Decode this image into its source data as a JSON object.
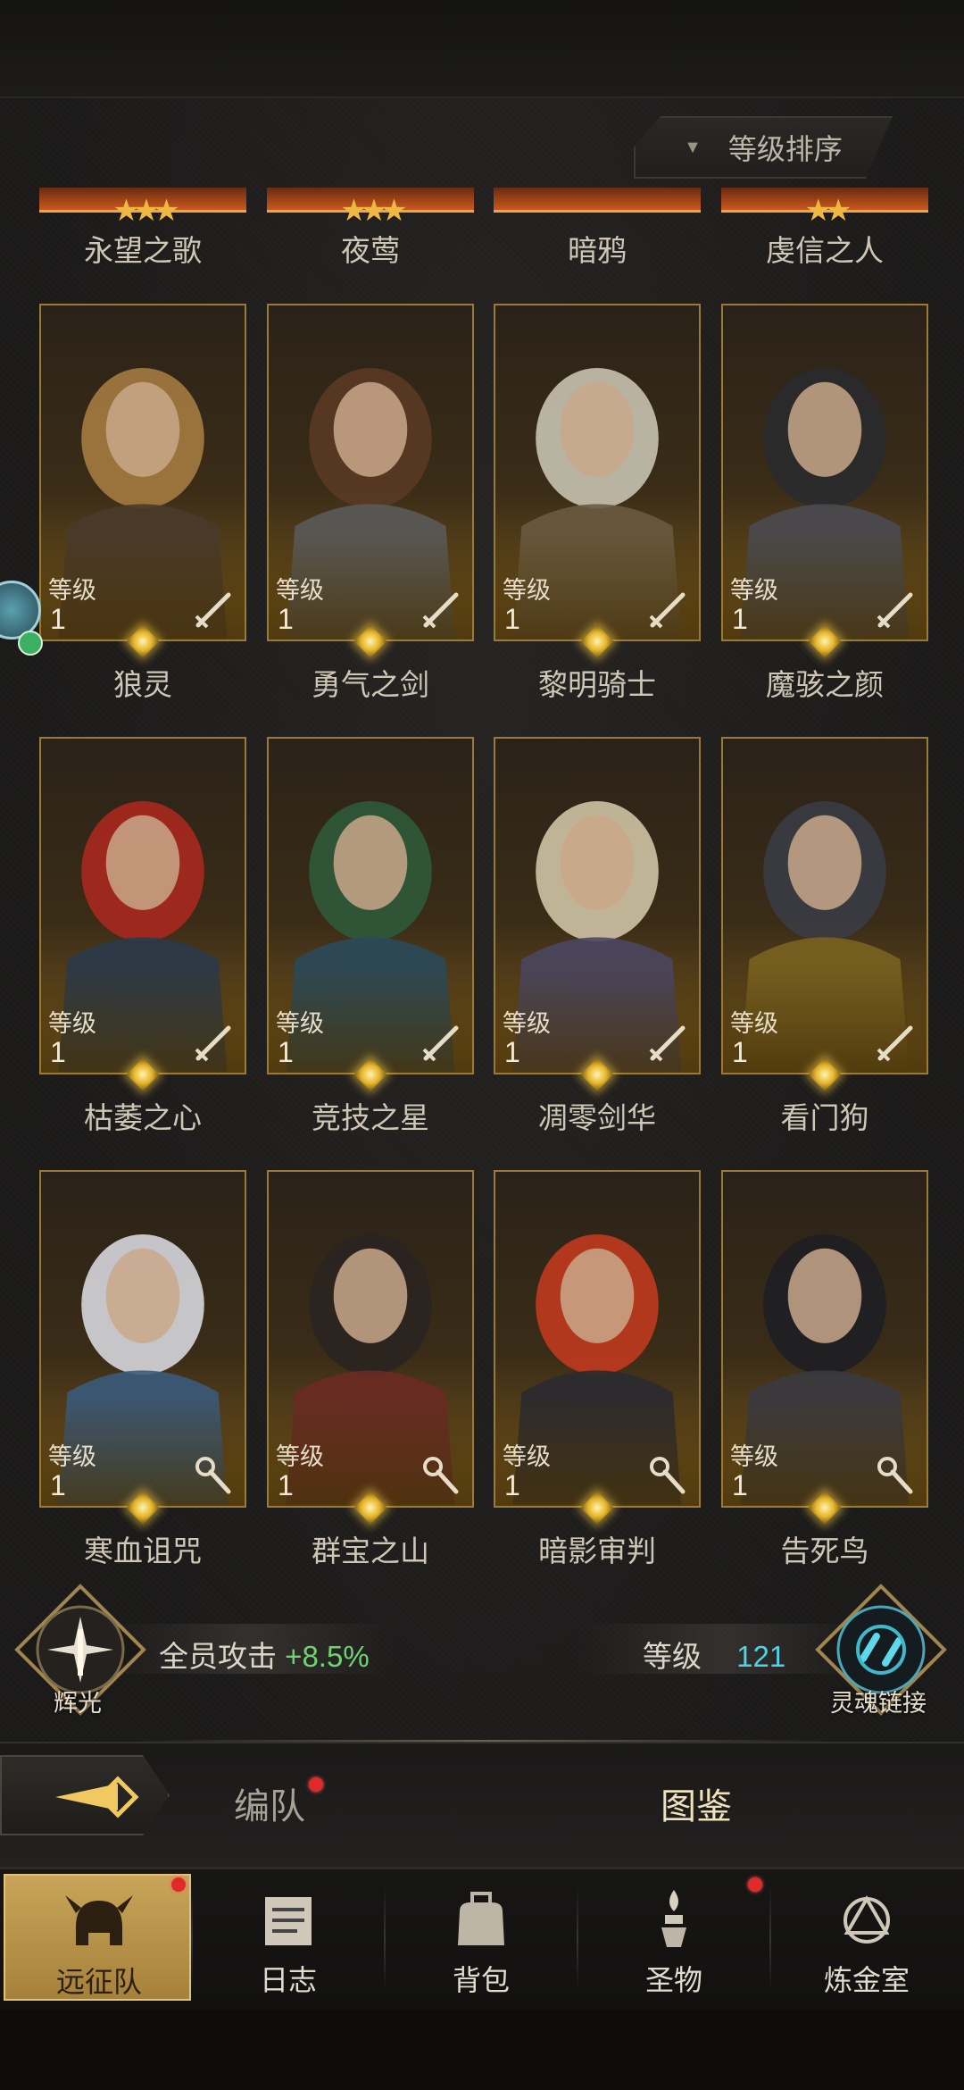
{
  "sort": {
    "label": "等级排序",
    "arrow": "▼"
  },
  "top_row": [
    {
      "name": "永望之歌",
      "stars": "★★★"
    },
    {
      "name": "夜莺",
      "stars": "★★★"
    },
    {
      "name": "暗鸦",
      "stars": ""
    },
    {
      "name": "虔信之人",
      "stars": "★★"
    }
  ],
  "heroes": [
    {
      "name": "狼灵",
      "level_label": "等级",
      "level": "1",
      "role": "sword-icon",
      "hair": "#a47a40",
      "robe": "#4a3a2a"
    },
    {
      "name": "勇气之剑",
      "level_label": "等级",
      "level": "1",
      "role": "sword-icon",
      "hair": "#5a3a24",
      "robe": "#5a5a5a"
    },
    {
      "name": "黎明骑士",
      "level_label": "等级",
      "level": "1",
      "role": "sword-icon",
      "hair": "#c8c2b0",
      "robe": "#6a5a40"
    },
    {
      "name": "魔骇之颜",
      "level_label": "等级",
      "level": "1",
      "role": "sword-icon",
      "hair": "#2a2a2e",
      "robe": "#4a4a50"
    },
    {
      "name": "枯萎之心",
      "level_label": "等级",
      "level": "1",
      "role": "sword-icon",
      "hair": "#a8281e",
      "robe": "#2a3a4a"
    },
    {
      "name": "竞技之星",
      "level_label": "等级",
      "level": "1",
      "role": "sword-icon",
      "hair": "#2f5a3a",
      "robe": "#2a4a5a"
    },
    {
      "name": "凋零剑华",
      "level_label": "等级",
      "level": "1",
      "role": "sword-icon",
      "hair": "#cfc3a4",
      "robe": "#4a4660"
    },
    {
      "name": "看门狗",
      "level_label": "等级",
      "level": "1",
      "role": "sword-icon",
      "hair": "#3a3c44",
      "robe": "#7a6220"
    },
    {
      "name": "寒血诅咒",
      "level_label": "等级",
      "level": "1",
      "role": "staff-icon",
      "hair": "#d6d6dc",
      "robe": "#3a5a7a"
    },
    {
      "name": "群宝之山",
      "level_label": "等级",
      "level": "1",
      "role": "staff-icon",
      "hair": "#2a2420",
      "robe": "#6a2a24"
    },
    {
      "name": "暗影审判",
      "level_label": "等级",
      "level": "1",
      "role": "staff-icon",
      "hair": "#c03a1e",
      "robe": "#2a2a30"
    },
    {
      "name": "告死鸟",
      "level_label": "等级",
      "level": "1",
      "role": "staff-icon",
      "hair": "#1e1e22",
      "robe": "#3a3a40"
    }
  ],
  "stats": {
    "left_emblem_label": "辉光",
    "attack_label": "全员攻击",
    "attack_value": "+8.5%",
    "level_label": "等级",
    "level_value": "121",
    "right_emblem_label": "灵魂链接"
  },
  "tabs": {
    "formation": "编队",
    "codex": "图鉴"
  },
  "nav": [
    {
      "label": "远征队",
      "icon": "helmet-icon",
      "active": true,
      "badge": true
    },
    {
      "label": "日志",
      "icon": "scroll-icon",
      "active": false,
      "badge": false
    },
    {
      "label": "背包",
      "icon": "bag-icon",
      "active": false,
      "badge": false
    },
    {
      "label": "圣物",
      "icon": "relic-icon",
      "active": false,
      "badge": true
    },
    {
      "label": "炼金室",
      "icon": "alchemy-icon",
      "active": false,
      "badge": false
    }
  ],
  "colors": {
    "accent_gold": "#c9a55a",
    "stat_green": "#6fd46f",
    "level_cyan": "#4fd1e6",
    "badge_red": "#e02a2a"
  }
}
